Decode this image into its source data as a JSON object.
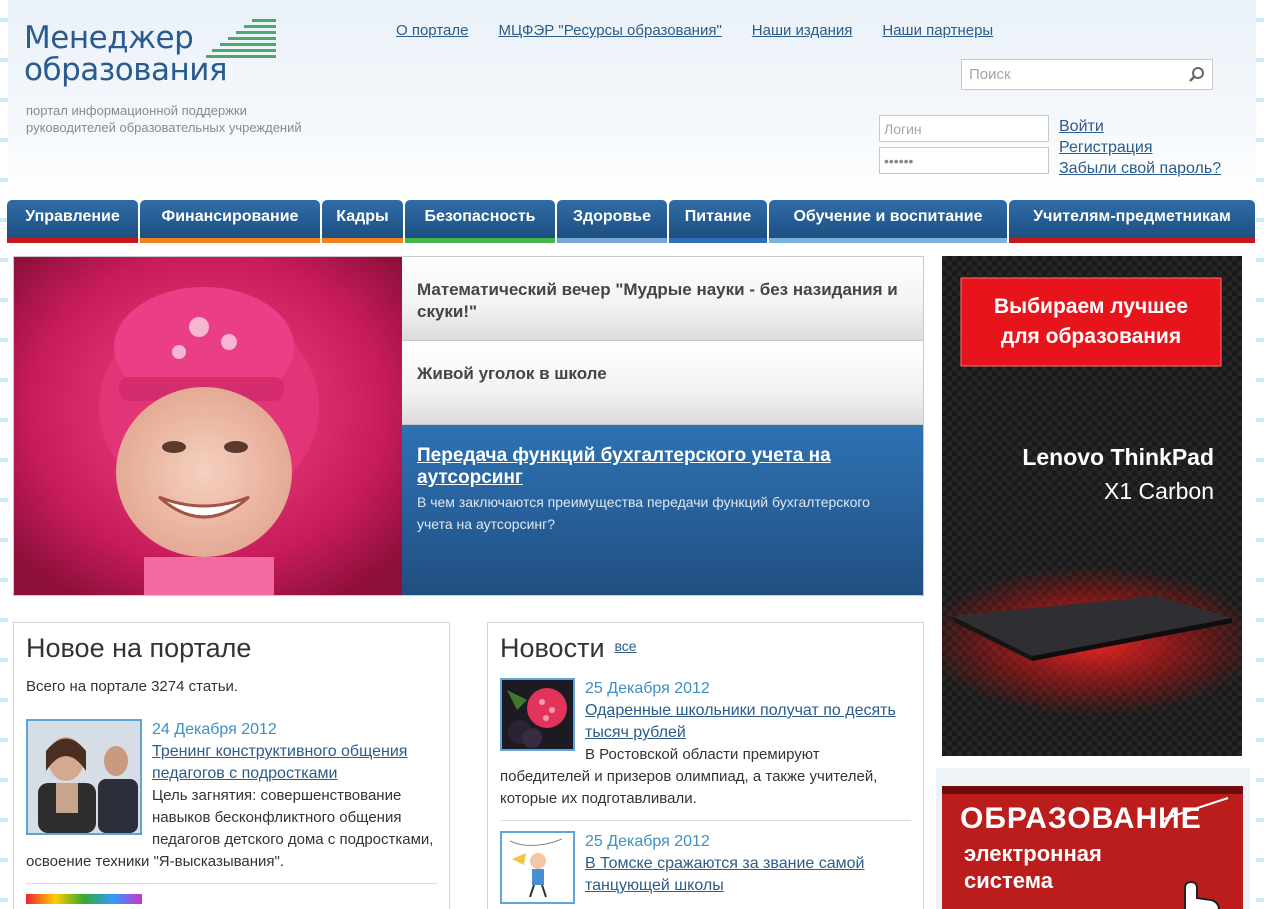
{
  "header": {
    "logo_title_line1": "Менеджер",
    "logo_title_line2": "образования",
    "logo_subtitle_line1": "портал информационной поддержки",
    "logo_subtitle_line2": "руководителей образовательных учреждений",
    "top_links": [
      "О портале",
      "МЦФЭР \"Ресурсы образования\"",
      "Наши издания",
      "Наши партнеры"
    ],
    "search_placeholder": "Поиск",
    "login_placeholder": "Логин",
    "password_value": "••••••",
    "login_link": "Войти",
    "register_link": "Регистрация",
    "forgot_link": "Забыли свой пароль?"
  },
  "mainnav": [
    {
      "label": "Управление",
      "color": "#c8161b"
    },
    {
      "label": "Финансирование",
      "color": "#f0821e"
    },
    {
      "label": "Кадры",
      "color": "#f0821e"
    },
    {
      "label": "Безопасность",
      "color": "#45b649"
    },
    {
      "label": "Здоровье",
      "color": "#79a8d6"
    },
    {
      "label": "Питание",
      "color": "#2c6fb8"
    },
    {
      "label": "Обучение и воспитание",
      "color": "#7ab4dd"
    },
    {
      "label": "Учителям-предметникам",
      "color": "#c8161b"
    }
  ],
  "hero": {
    "items": [
      {
        "title": "Математический вечер \"Мудрые науки - без назидания и скуки!\""
      },
      {
        "title": "Живой уголок в школе"
      },
      {
        "title": "Передача функций бухгалтерского учета на аутсорсинг",
        "description": "В чем заключаются преимущества передачи функций бухгалтерского учета на аутсорсинг?"
      }
    ]
  },
  "new_on_portal": {
    "title": "Новое на портале",
    "count_text": "Всего на портале 3274 статьи.",
    "entries": [
      {
        "date": "24 Декабря 2012",
        "title": "Тренинг конструктивного общения педагогов с подростками",
        "text": "Цель загнятия: совершенствование навыков бесконфликтного общения педагогов детского дома с подростками, освоение техники \"Я-высказывания\"."
      }
    ]
  },
  "news": {
    "title": "Новости",
    "all_link": "все",
    "entries": [
      {
        "date": "25 Декабря 2012",
        "title": "Одаренные школьники получат по десять тысяч рублей",
        "text": "В Ростовской области премируют победителей и призеров олимпиад, а также учителей, которые их подготавливали."
      },
      {
        "date": "25 Декабря 2012",
        "title": "В Томске сражаются за звание самой танцующей школы",
        "text": ""
      }
    ]
  },
  "banner1": {
    "headline_line1": "Выбираем лучшее",
    "headline_line2": "для образования",
    "product_line1": "Lenovo ThinkPad",
    "product_line2": "X1 Carbon"
  },
  "banner2": {
    "line1": "ОБРАЗОВАНИЕ",
    "line2": "электронная",
    "line3": "система"
  }
}
